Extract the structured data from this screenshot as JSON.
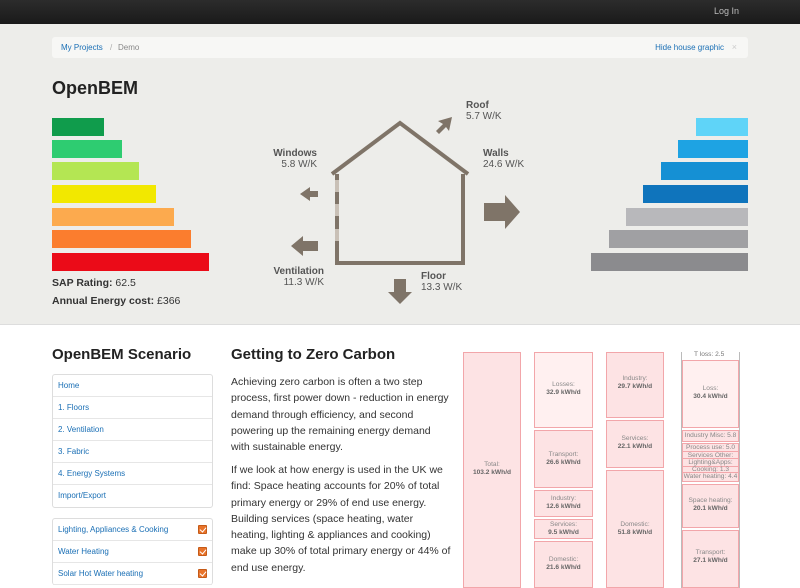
{
  "topbar": {
    "login": "Log In"
  },
  "breadcrumb": {
    "projects": "My Projects",
    "separator": "/",
    "current": "Demo",
    "hide": "Hide house graphic",
    "close": "×"
  },
  "header": {
    "title": "OpenBEM"
  },
  "sap": {
    "rating_label": "SAP Rating:",
    "rating_value": "62.5",
    "cost_label": "Annual Energy cost:",
    "cost_value": "£366",
    "bar_colors": [
      "#109c4c",
      "#2ecc71",
      "#b4e653",
      "#f2e800",
      "#fcaa4e",
      "#fb7d2e",
      "#eb0b18"
    ]
  },
  "heatloss": {
    "roof": {
      "label": "Roof",
      "value": "5.7 W/K"
    },
    "windows": {
      "label": "Windows",
      "value": "5.8 W/K"
    },
    "walls": {
      "label": "Walls",
      "value": "24.6 W/K"
    },
    "ventilation": {
      "label": "Ventilation",
      "value": "11.3 W/K"
    },
    "floor": {
      "label": "Floor",
      "value": "13.3 W/K"
    }
  },
  "energy_bars": {
    "colors": [
      "#5fd4f8",
      "#1ea3e3",
      "#1590d4",
      "#0f74bc",
      "#b8b8bb",
      "#a0a0a3",
      "#8b8b8e"
    ]
  },
  "scenario": {
    "title": "OpenBEM Scenario",
    "nav": [
      "Home",
      "1. Floors",
      "2. Ventilation",
      "3. Fabric",
      "4. Energy Systems",
      "Import/Export"
    ],
    "measures": [
      "Lighting, Appliances & Cooking",
      "Water Heating",
      "Solar Hot Water heating"
    ]
  },
  "article": {
    "title": "Getting to Zero Carbon",
    "p1": "Achieving zero carbon is often a two step process, first power down - reduction in energy demand through efficiency, and second powering up the remaining energy demand with sustainable energy.",
    "p2": "If we look at how energy is used in the UK we find: Space heating accounts for 20% of total primary energy or 29% of end use energy. Building services (space heating, water heating, lighting & appliances and cooking) make up 30% of total primary energy or 44% of end use energy."
  },
  "energy_stack": {
    "total": {
      "label": "Total:",
      "value": "103.2 kWh/d"
    },
    "col2": [
      {
        "label": "Losses:",
        "value": "32.9 kWh/d"
      },
      {
        "label": "Transport:",
        "value": "26.6 kWh/d"
      },
      {
        "label": "Industry:",
        "value": "12.6 kWh/d"
      },
      {
        "label": "Services:",
        "value": "9.5 kWh/d"
      },
      {
        "label": "Domestic:",
        "value": "21.6 kWh/d"
      }
    ],
    "col3": [
      {
        "label": "Industry:",
        "value": "29.7 kWh/d"
      },
      {
        "label": "Services:",
        "value": "22.1 kWh/d"
      },
      {
        "label": "Domestic:",
        "value": "51.8 kWh/d"
      }
    ],
    "col4": {
      "tloss": "T loss: 2.5",
      "loss": {
        "label": "Loss:",
        "value": "30.4 kWh/d"
      },
      "small": [
        "Industry Misc: 5.8",
        "Process use: 5.0",
        "Services Other: 1.3",
        "Lighting&Apps: 5.0",
        "Cooking: 1.3",
        "Water heating: 4.4"
      ],
      "space": {
        "label": "Space heating:",
        "value": "20.1 kWh/d"
      },
      "transport": {
        "label": "Transport:",
        "value": "27.1 kWh/d"
      }
    }
  }
}
